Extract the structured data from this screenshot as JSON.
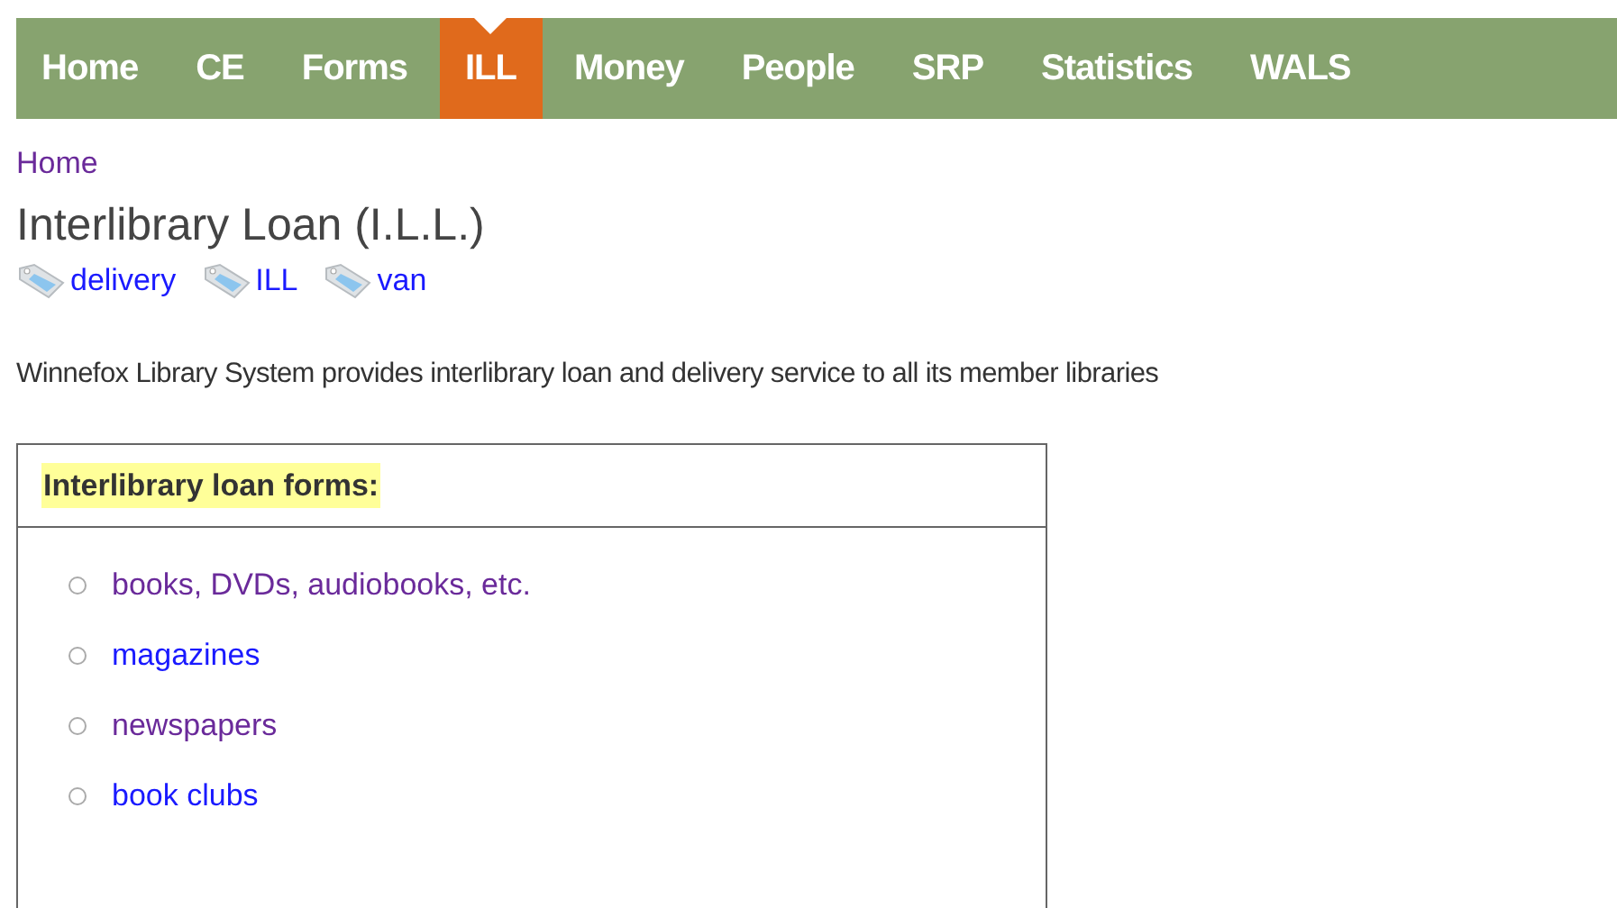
{
  "nav": [
    {
      "label": "Home",
      "selected": false
    },
    {
      "label": "CE",
      "selected": false
    },
    {
      "label": "Forms",
      "selected": false
    },
    {
      "label": "ILL",
      "selected": true
    },
    {
      "label": "Money",
      "selected": false
    },
    {
      "label": "People",
      "selected": false
    },
    {
      "label": "SRP",
      "selected": false
    },
    {
      "label": "Statistics",
      "selected": false
    },
    {
      "label": "WALS",
      "selected": false
    }
  ],
  "breadcrumb": {
    "label": "Home",
    "visited": true
  },
  "title": "Interlibrary Loan (I.L.L.)",
  "tags": [
    {
      "label": "delivery",
      "visited": false
    },
    {
      "label": "ILL",
      "visited": false
    },
    {
      "label": "van",
      "visited": false
    }
  ],
  "intro": "Winnefox Library System provides interlibrary loan and delivery service to all its member libraries",
  "forms_box": {
    "heading": "Interlibrary loan forms:",
    "links": [
      {
        "label": "books, DVDs, audiobooks, etc.",
        "visited": true
      },
      {
        "label": "magazines",
        "visited": false
      },
      {
        "label": "newspapers",
        "visited": true
      },
      {
        "label": "book clubs",
        "visited": false
      }
    ]
  }
}
